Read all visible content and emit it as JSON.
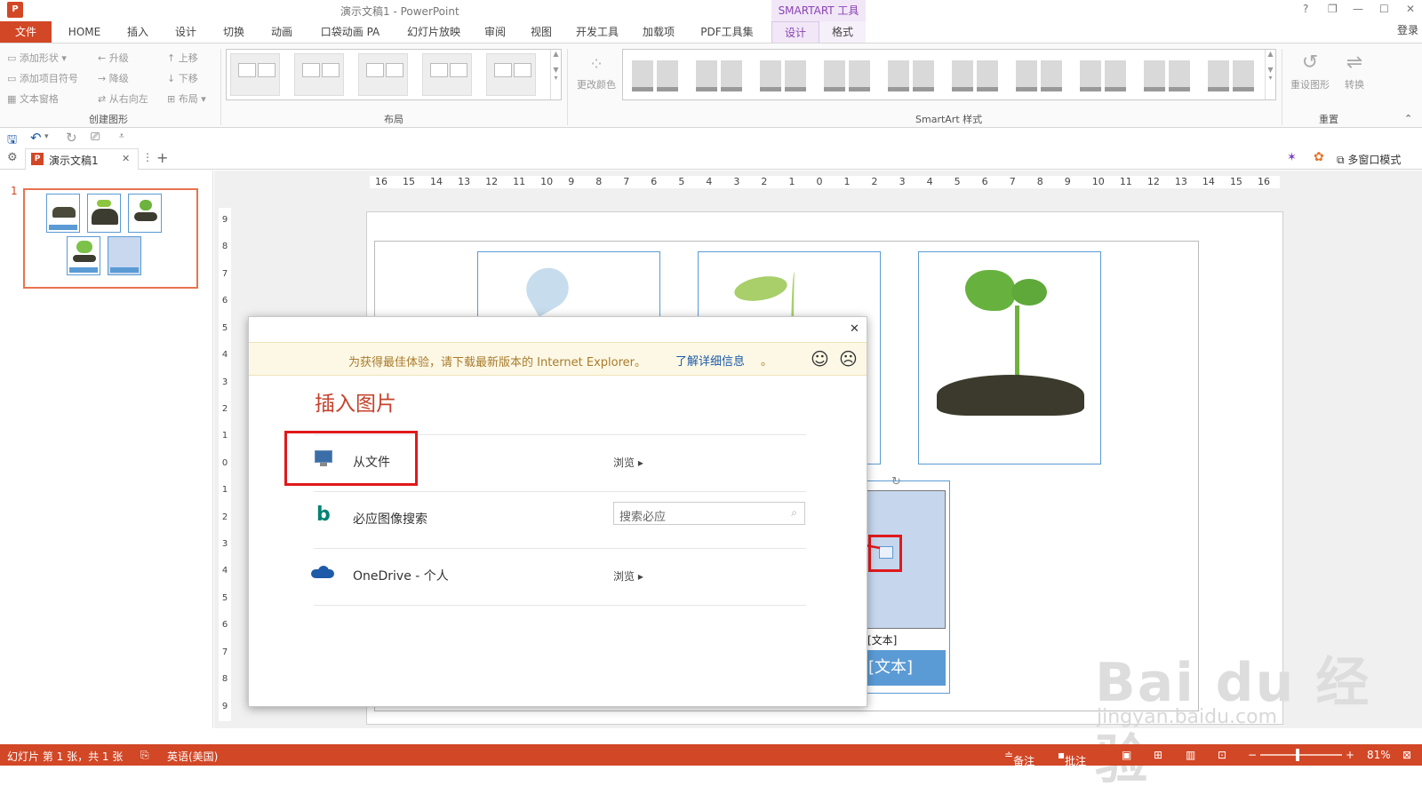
{
  "window": {
    "title": "演示文稿1 - PowerPoint",
    "context_group": "SMARTART 工具",
    "help": "?",
    "restore": "❐",
    "minimize": "—",
    "maximize": "☐",
    "close": "✕"
  },
  "tabs": [
    {
      "label": "文件"
    },
    {
      "label": "HOME"
    },
    {
      "label": "插入"
    },
    {
      "label": "设计"
    },
    {
      "label": "切换"
    },
    {
      "label": "动画"
    },
    {
      "label": "口袋动画 PA"
    },
    {
      "label": "幻灯片放映"
    },
    {
      "label": "审阅"
    },
    {
      "label": "视图"
    },
    {
      "label": "开发工具"
    },
    {
      "label": "加载项"
    },
    {
      "label": "PDF工具集"
    },
    {
      "label": "设计"
    },
    {
      "label": "格式"
    }
  ],
  "account": {
    "login": "登录"
  },
  "ribbon": {
    "create": {
      "add_shape": "添加形状",
      "add_bullet": "添加项目符号",
      "text_pane": "文本窗格",
      "promote": "升级",
      "demote": "降级",
      "rtl": "从右向左",
      "move_up": "上移",
      "move_down": "下移",
      "layout": "布局",
      "label": "创建图形"
    },
    "layouts": {
      "label": "布局"
    },
    "styles": {
      "change_colors": "更改颜色",
      "label": "SmartArt 样式"
    },
    "reset": {
      "reset_graphic": "重设图形",
      "convert": "转换",
      "label": "重置"
    }
  },
  "doc_tab": {
    "name": "演示文稿1",
    "multiwindow": "多窗口模式"
  },
  "thumbs": {
    "slide_number": "1"
  },
  "ruler": {
    "h": [
      "16",
      "15",
      "14",
      "13",
      "12",
      "11",
      "10",
      "9",
      "8",
      "7",
      "6",
      "5",
      "4",
      "3",
      "2",
      "1",
      "0",
      "1",
      "2",
      "3",
      "4",
      "5",
      "6",
      "7",
      "8",
      "9",
      "10",
      "11",
      "12",
      "13",
      "14",
      "15",
      "16"
    ],
    "v": [
      "9",
      "8",
      "7",
      "6",
      "5",
      "4",
      "3",
      "2",
      "1",
      "0",
      "1",
      "2",
      "3",
      "4",
      "5",
      "6",
      "7",
      "8",
      "9"
    ]
  },
  "slide": {
    "text_placeholder": "[文本]",
    "text_box": "[文本]"
  },
  "dialog": {
    "close": "✕",
    "ie_notice": "为获得最佳体验，请下载最新版本的 Internet Explorer。",
    "ie_link": "了解详细信息",
    "ie_dot": "。",
    "smile": "☺",
    "frown": "☹",
    "title": "插入图片",
    "rows": [
      {
        "label": "从文件",
        "action": "浏览"
      },
      {
        "label": "必应图像搜索",
        "placeholder": "搜索必应"
      },
      {
        "label": "OneDrive - 个人",
        "action": "浏览"
      }
    ]
  },
  "status": {
    "slide_info": "幻灯片 第 1 张，共 1 张",
    "language": "英语(美国)",
    "notes": "备注",
    "comments": "批注",
    "zoom": "81%"
  },
  "watermark": {
    "brand": "Bai du 经验",
    "url": "jingyan.baidu.com"
  },
  "colors": {
    "accent": "#d24726",
    "smartart": "#8a43b5",
    "frame": "#5b9bd5",
    "annotation": "#e0191b"
  }
}
